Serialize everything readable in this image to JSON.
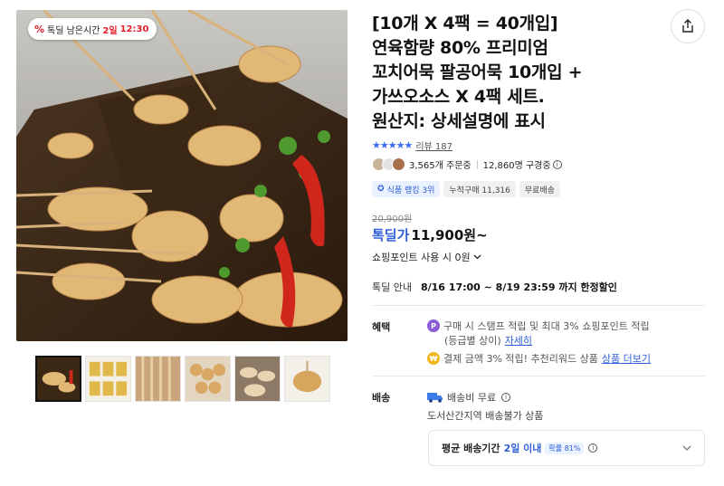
{
  "deal_chip": {
    "icon": "percent-icon",
    "label": "톡딜 남은시간",
    "days": "2일",
    "time": "12:30"
  },
  "title_lines": [
    "[10개 X 4팩 = 40개입]",
    "연육함량 80% 프리미엄",
    "꼬치어묵 팔공어묵 10개입 +",
    "가쓰오소스 X 4팩 세트.",
    "원산지: 상세설명에 표시"
  ],
  "rating": {
    "stars": "★★★★★",
    "review_text": "리뷰 187"
  },
  "stats": {
    "orders": "3,565개 주문중",
    "subscribers": "12,860명 구경중"
  },
  "badges": {
    "ranking": "식품 랭킹 3위",
    "cumulative": "누적구매 11,316",
    "shipping": "무료배송"
  },
  "price": {
    "original": "20,900원",
    "deal_label": "톡딜가",
    "deal_value": "11,900원~"
  },
  "points_text": "쇼핑포인트 사용 시 0원",
  "deal_info": {
    "label": "톡딜 안내",
    "value": "8/16 17:00 ~ 8/19 23:59 까지 한정할인"
  },
  "benefits": {
    "label": "혜택",
    "line1": "구매 시 스탬프 적립 및 최대 3% 쇼핑포인트 적립",
    "line2": "(등급별 상이)",
    "line2_link": "자세히",
    "line3": "결제 금액 3% 적립! 추천리워드 상품",
    "line3_link": "상품 더보기"
  },
  "shipping": {
    "label": "배송",
    "fee": "배송비 무료",
    "note": "도서산간지역 배송불가 상품",
    "avg_label": "평균 배송기간",
    "avg_value": "2일 이내",
    "probability": "확률 81%"
  },
  "colors": {
    "accent_blue": "#2f5fd8",
    "deal_red": "#e5202b"
  }
}
